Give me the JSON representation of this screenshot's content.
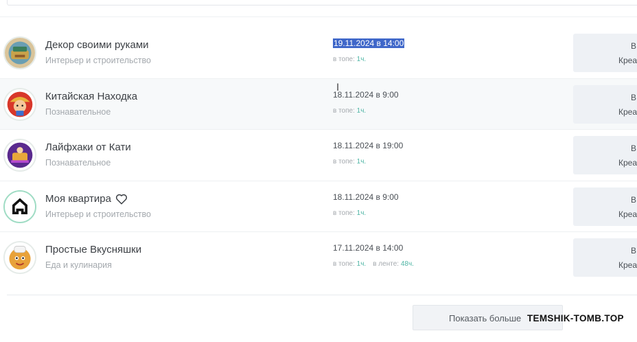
{
  "channels": [
    {
      "name": "Декор своими руками",
      "category": "Интерьер и строительство",
      "date": "19.11.2024 в 14:00",
      "selected": true,
      "in_top_label": "в топе:",
      "in_top_value": "1ч.",
      "action_line1": "В",
      "action_line2": "Креа",
      "icon": "decor-avatar-icon"
    },
    {
      "name": "Китайская Находка",
      "category": "Познавательное",
      "date": "18.11.2024 в 9:00",
      "selected": false,
      "in_top_label": "в топе:",
      "in_top_value": "1ч.",
      "action_line1": "В",
      "action_line2": "Креа",
      "icon": "chinese-find-avatar-icon"
    },
    {
      "name": "Лайфхаки от Кати",
      "category": "Познавательное",
      "date": "18.11.2024 в 19:00",
      "selected": false,
      "in_top_label": "в топе:",
      "in_top_value": "1ч.",
      "action_line1": "В",
      "action_line2": "Креа",
      "icon": "lifehacks-avatar-icon"
    },
    {
      "name": "Моя квартира",
      "category": "Интерьер и строительство",
      "date": "18.11.2024 в 9:00",
      "selected": false,
      "in_top_label": "в топе:",
      "in_top_value": "1ч.",
      "action_line1": "В",
      "action_line2": "Креа",
      "icon": "house-avatar-icon",
      "badge": "heart-icon"
    },
    {
      "name": "Простые Вкусняшки",
      "category": "Еда и кулинария",
      "date": "17.11.2024 в 14:00",
      "selected": false,
      "in_top_label": "в топе:",
      "in_top_value": "1ч.",
      "in_feed_label": "в ленте:",
      "in_feed_value": "48ч.",
      "action_line1": "В",
      "action_line2": "Креа",
      "icon": "tasty-avatar-icon"
    }
  ],
  "show_more_label": "Показать больше",
  "watermark": "TEMSHIK-TOMB.TOP",
  "colors": {
    "accent": "#4fb5a5",
    "selection": "#3f67c9",
    "alt_row": "#f7f9fa"
  }
}
